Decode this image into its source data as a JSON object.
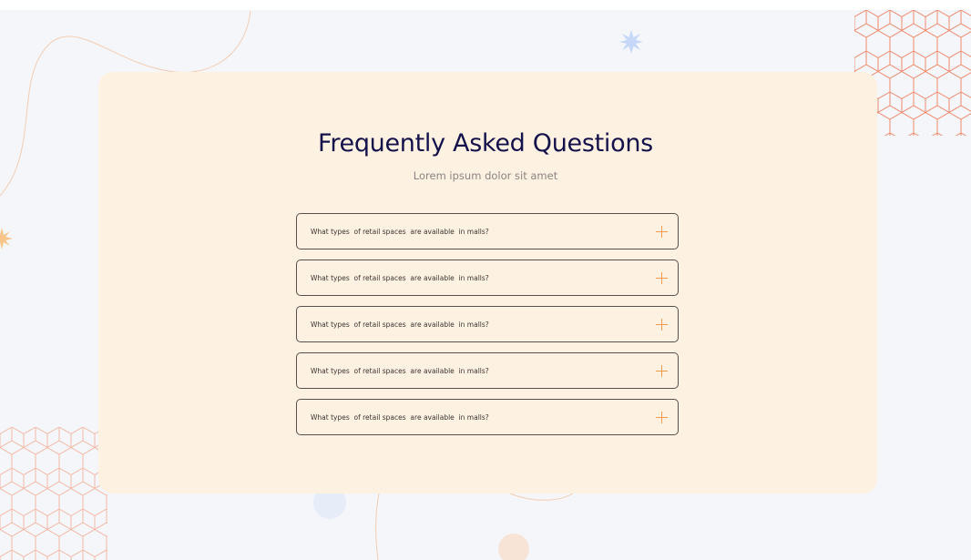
{
  "faq": {
    "title": "Frequently Asked Questions",
    "subtitle": "Lorem ipsum dolor sit amet",
    "items": [
      {
        "question": "What types  of retail spaces  are available  in malls?",
        "icon": "plus-icon"
      },
      {
        "question": "What types  of retail spaces  are available  in malls?",
        "icon": "plus-icon"
      },
      {
        "question": "What types  of retail spaces  are available  in malls?",
        "icon": "plus-icon"
      },
      {
        "question": "What types  of retail spaces  are available  in malls?",
        "icon": "plus-icon"
      },
      {
        "question": "What types  of retail spaces  are available  in malls?",
        "icon": "plus-icon"
      }
    ]
  },
  "colors": {
    "page_background": "#f4f6fa",
    "panel_background": "#fdf1e2",
    "title": "#14124a",
    "subtitle": "#8a8580",
    "item_border": "#55504a",
    "accent_plus": "#ef9a4a",
    "hex_pattern_top": "#ee8a6c",
    "hex_pattern_bottom": "#f3b9a4",
    "star_blue": "#c6d7f7",
    "star_orange": "#f7c58a"
  }
}
